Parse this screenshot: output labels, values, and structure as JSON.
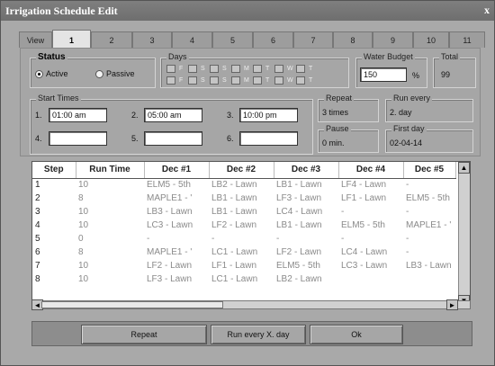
{
  "window": {
    "title": "Irrigation Schedule Edit",
    "close_glyph": "x"
  },
  "tabs": [
    "View",
    "1",
    "2",
    "3",
    "4",
    "5",
    "6",
    "7",
    "8",
    "9",
    "10",
    "11"
  ],
  "active_tab": "1",
  "status": {
    "label": "Status",
    "options": [
      "Active",
      "Passive"
    ],
    "selected": "Active"
  },
  "days": {
    "label": "Days",
    "row1_letters": [
      "F",
      "S",
      "S",
      "M",
      "T",
      "W",
      "T"
    ],
    "row2_letters": [
      "F",
      "S",
      "S",
      "M",
      "T",
      "W",
      "T"
    ]
  },
  "water_budget": {
    "label": "Water Budget",
    "value": "150",
    "unit": "%"
  },
  "total": {
    "label": "Total",
    "value": "99"
  },
  "start_times": {
    "label": "Start Times",
    "slots": [
      {
        "num": "1.",
        "value": "01:00 am"
      },
      {
        "num": "2.",
        "value": "05:00 am"
      },
      {
        "num": "3.",
        "value": "10:00 pm"
      },
      {
        "num": "4.",
        "value": ""
      },
      {
        "num": "5.",
        "value": ""
      },
      {
        "num": "6.",
        "value": ""
      }
    ]
  },
  "repeat": {
    "label": "Repeat",
    "value": "3 times"
  },
  "run_every": {
    "label": "Run every",
    "value": "2. day"
  },
  "pause": {
    "label": "Pause",
    "value": "0 min."
  },
  "first_day": {
    "label": "First day",
    "value": "02-04-14"
  },
  "grid": {
    "headers": [
      "Step",
      "Run Time",
      "Dec #1",
      "Dec #2",
      "Dec #3",
      "Dec #4",
      "Dec #5"
    ],
    "rows": [
      [
        "1",
        "10",
        "ELM5 - 5th",
        "LB2 - Lawn",
        "LB1 - Lawn",
        "LF4 - Lawn",
        "-"
      ],
      [
        "2",
        "8",
        "MAPLE1 - '",
        "LB1 - Lawn",
        "LF3 - Lawn",
        "LF1 - Lawn",
        "ELM5 - 5th"
      ],
      [
        "3",
        "10",
        "LB3 - Lawn",
        "LB1 - Lawn",
        "LC4 - Lawn",
        "-",
        "-"
      ],
      [
        "4",
        "10",
        "LC3 - Lawn",
        "LF2 - Lawn",
        "LB1 - Lawn",
        "ELM5 - 5th",
        "MAPLE1 - '"
      ],
      [
        "5",
        "0",
        "-",
        "-",
        "-",
        "-",
        "-"
      ],
      [
        "6",
        "8",
        "MAPLE1 - '",
        "LC1 - Lawn",
        "LF2 - Lawn",
        "LC4 - Lawn",
        "-"
      ],
      [
        "7",
        "10",
        "LF2 - Lawn",
        "LF1 - Lawn",
        "ELM5 - 5th",
        "LC3 - Lawn",
        "LB3 - Lawn"
      ],
      [
        "8",
        "10",
        "LF3 - Lawn",
        "LC1 - Lawn",
        "LB2 - Lawn",
        "",
        ""
      ]
    ]
  },
  "buttons": {
    "repeat": "Repeat",
    "run_every": "Run every X. day",
    "ok": "Ok"
  },
  "icons": {
    "scroll_up": "▲",
    "scroll_down": "▼",
    "scroll_left": "◄",
    "scroll_right": "►"
  },
  "colors": {
    "window_bg": "#a9a9a9",
    "grid_text": "#8a8a8a",
    "active_tab": "#e4e4e4"
  }
}
